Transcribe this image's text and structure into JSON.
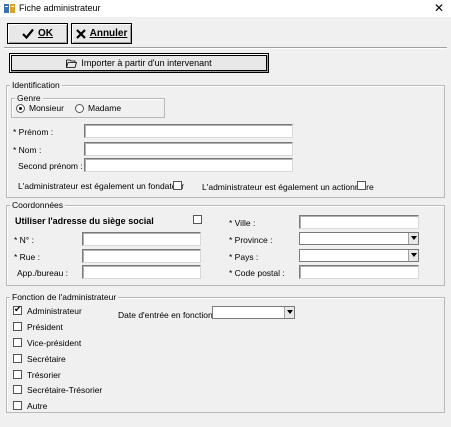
{
  "window": {
    "title": "Fiche administrateur",
    "close_glyph": "✕"
  },
  "toolbar": {
    "ok_label": "OK",
    "cancel_label": "Annuler",
    "import_label": "Importer à partir d'un intervenant"
  },
  "identification": {
    "group_label": "Identification",
    "genre_label": "Genre",
    "radio_monsieur": "Monsieur",
    "radio_madame": "Madame",
    "genre_selected": "Monsieur",
    "prenom_label": "* Prénom :",
    "nom_label": "* Nom :",
    "second_prenom_label": "Second prénom :",
    "fondateur_label": "L'administrateur est également un fondateur",
    "actionnaire_label": "L'administrateur est également un actionnaire"
  },
  "coordonnees": {
    "group_label": "Coordonnées",
    "siege_label": "Utiliser l'adresse du siège social",
    "no_label": "* N° :",
    "rue_label": "* Rue :",
    "app_label": "App./bureau :",
    "ville_label": "* Ville :",
    "province_label": "* Province :",
    "pays_label": "* Pays :",
    "code_postal_label": "* Code postal :"
  },
  "fonction": {
    "group_label": "Fonction de l'administrateur",
    "date_label": "Date d'entrée en fonction :",
    "roles": [
      {
        "label": "Administrateur",
        "checked": true
      },
      {
        "label": "Président",
        "checked": false
      },
      {
        "label": "Vice-président",
        "checked": false
      },
      {
        "label": "Secrétaire",
        "checked": false
      },
      {
        "label": "Trésorier",
        "checked": false
      },
      {
        "label": "Secrétaire-Trésorier",
        "checked": false
      },
      {
        "label": "Autre",
        "checked": false
      }
    ]
  },
  "icons": {
    "ok": "check-icon",
    "cancel": "x-icon",
    "import": "folder-open-icon",
    "app": "app-icon",
    "close": "close-icon"
  }
}
